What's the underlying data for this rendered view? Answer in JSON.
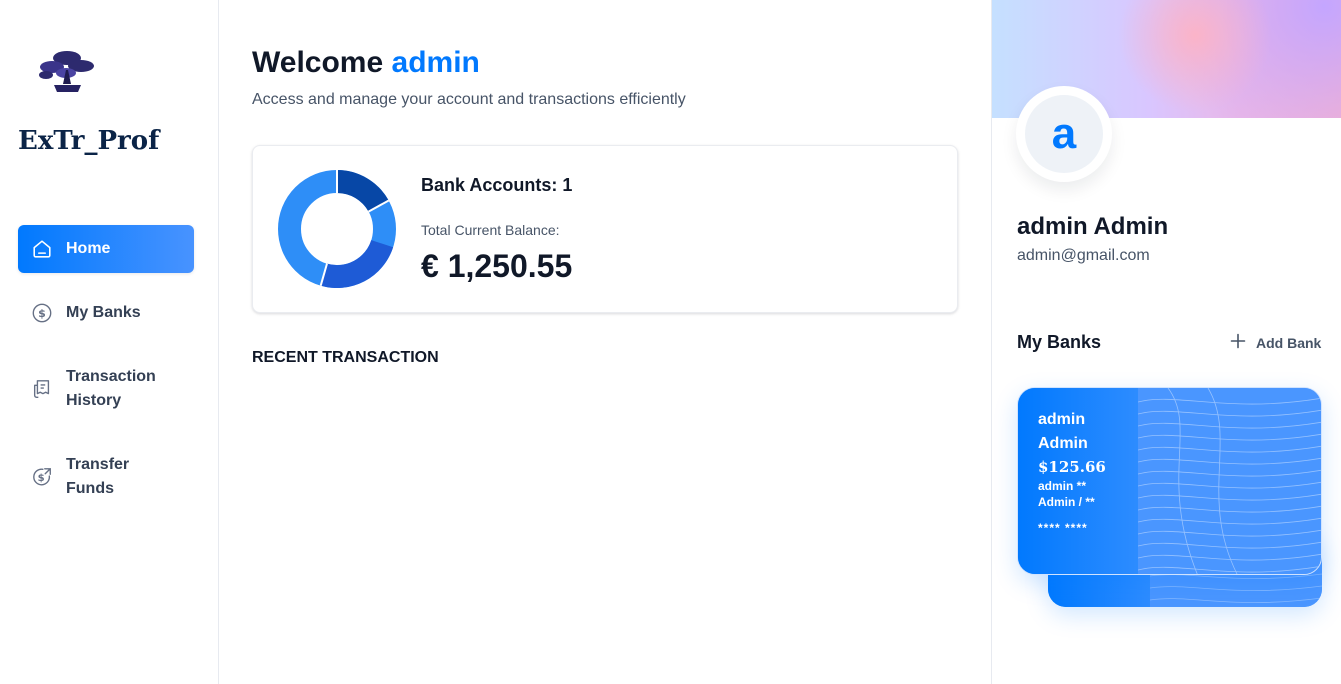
{
  "sidebar": {
    "brand": "ExTr_Prof",
    "items": [
      {
        "label": "Home",
        "icon": "home-icon",
        "active": true
      },
      {
        "label": "My Banks",
        "icon": "dollar-circle-icon",
        "active": false
      },
      {
        "label": "Transaction\nHistory",
        "icon": "receipt-icon",
        "active": false
      },
      {
        "label": "Transfer\nFunds",
        "icon": "money-send-icon",
        "active": false
      }
    ]
  },
  "header": {
    "welcome": "Welcome",
    "user": "admin",
    "subtitle": "Access and manage your account and transactions efficiently"
  },
  "balance": {
    "accounts_label": "Bank Accounts: 1",
    "total_label": "Total Current Balance:",
    "total_value": "€ 1,250.55"
  },
  "recent": {
    "title": "RECENT TRANSACTION"
  },
  "profile": {
    "initial": "a",
    "name": "admin Admin",
    "email": "admin@gmail.com"
  },
  "banks": {
    "title": "My Banks",
    "add_label": "Add Bank",
    "card": {
      "name": "admin Admin",
      "balance": "$125.66",
      "owner": "admin ** Admin / **",
      "number": "**** ****"
    },
    "back_card_text": "*** **** ** ****"
  },
  "colors": {
    "accent": "#0179fe",
    "text_dark": "#101828",
    "text_muted": "#475467"
  }
}
